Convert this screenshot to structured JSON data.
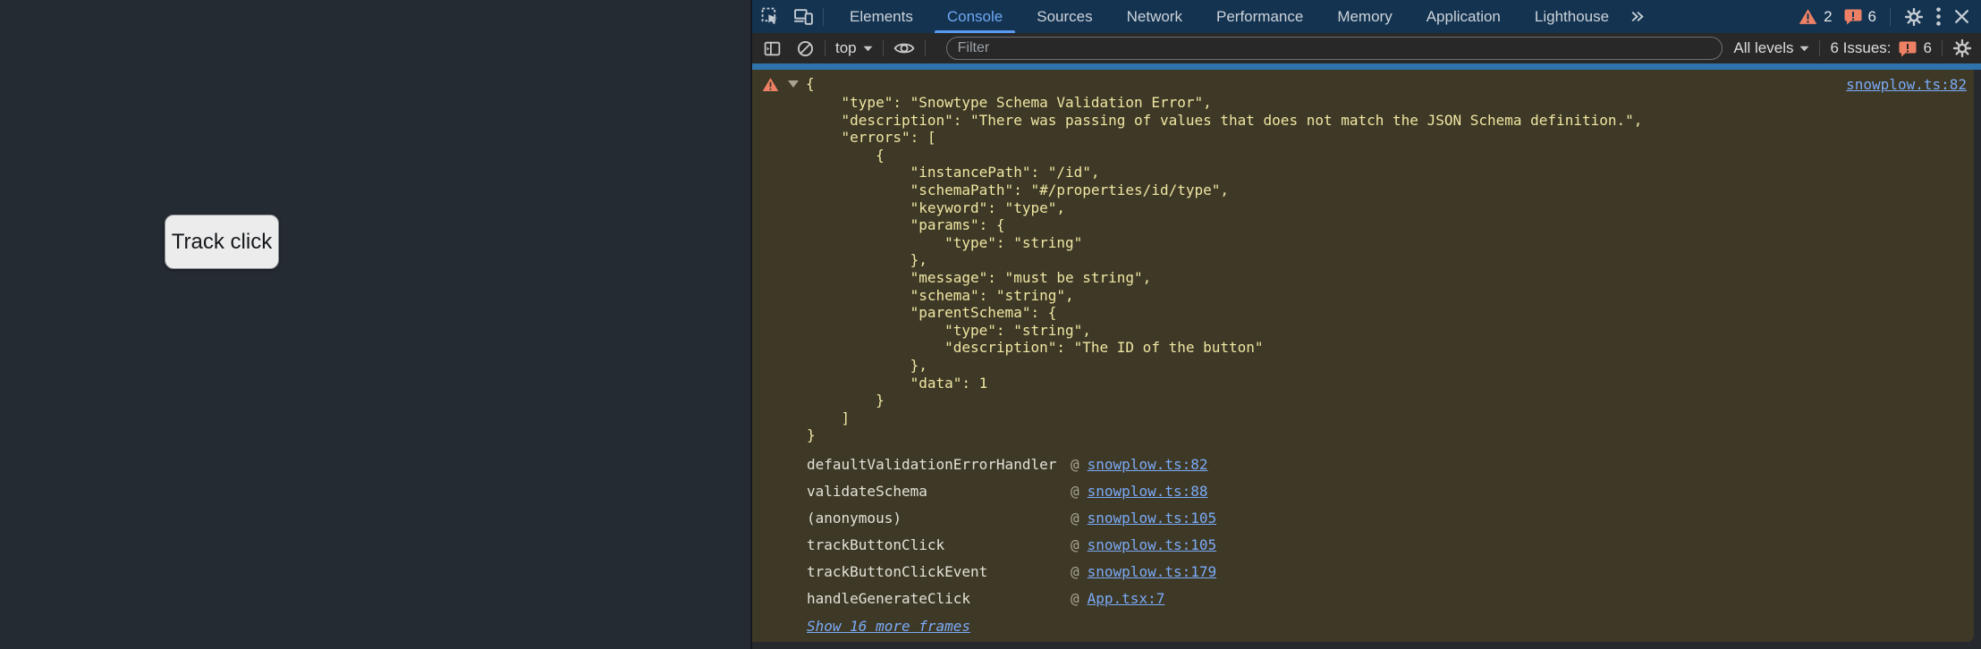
{
  "colors": {
    "page_bg": "#252b33",
    "tabbar_bg": "#143350",
    "toolbar_bg": "#282828",
    "console_bg": "#26292e",
    "warning_bg": "#3e3826",
    "warning_text": "#efe7a3",
    "link_blue": "#7aabf7",
    "tab_active_blue": "#6ea8f4",
    "toolbar_accent_line": "#2f73ad",
    "warning_orange": "#ee8165",
    "icon_gray": "#c6cdd4"
  },
  "page": {
    "track_button_label": "Track click"
  },
  "devtools": {
    "tabbar": {
      "tabs": [
        {
          "label": "Elements",
          "selected": false
        },
        {
          "label": "Console",
          "selected": true
        },
        {
          "label": "Sources",
          "selected": false
        },
        {
          "label": "Network",
          "selected": false
        },
        {
          "label": "Performance",
          "selected": false
        },
        {
          "label": "Memory",
          "selected": false
        },
        {
          "label": "Application",
          "selected": false
        },
        {
          "label": "Lighthouse",
          "selected": false
        }
      ],
      "warning_count": "2",
      "issue_count": "6"
    },
    "toolbar": {
      "context_selector_value": "top",
      "filter_placeholder": "Filter",
      "levels_selector_value": "All levels",
      "issues_label": "6 Issues:",
      "issues_count": "6"
    },
    "console": {
      "first_line": "{",
      "source_link": "snowplow.ts:82",
      "json_lines": [
        "    \"type\": \"Snowtype Schema Validation Error\",",
        "    \"description\": \"There was passing of values that does not match the JSON Schema definition.\",",
        "    \"errors\": [",
        "        {",
        "            \"instancePath\": \"/id\",",
        "            \"schemaPath\": \"#/properties/id/type\",",
        "            \"keyword\": \"type\",",
        "            \"params\": {",
        "                \"type\": \"string\"",
        "            },",
        "            \"message\": \"must be string\",",
        "            \"schema\": \"string\",",
        "            \"parentSchema\": {",
        "                \"type\": \"string\",",
        "                \"description\": \"The ID of the button\"",
        "            },",
        "            \"data\": 1",
        "        }",
        "    ]",
        "}"
      ],
      "stack_frames": [
        {
          "fn": "defaultValidationErrorHandler",
          "at": "@",
          "location": "snowplow.ts:82"
        },
        {
          "fn": "validateSchema",
          "at": "@",
          "location": "snowplow.ts:88"
        },
        {
          "fn": "(anonymous)",
          "at": "@",
          "location": "snowplow.ts:105"
        },
        {
          "fn": "trackButtonClick",
          "at": "@",
          "location": "snowplow.ts:105"
        },
        {
          "fn": "trackButtonClickEvent",
          "at": "@",
          "location": "snowplow.ts:179"
        },
        {
          "fn": "handleGenerateClick",
          "at": "@",
          "location": "App.tsx:7"
        }
      ],
      "show_more_label": "Show 16 more frames"
    }
  }
}
